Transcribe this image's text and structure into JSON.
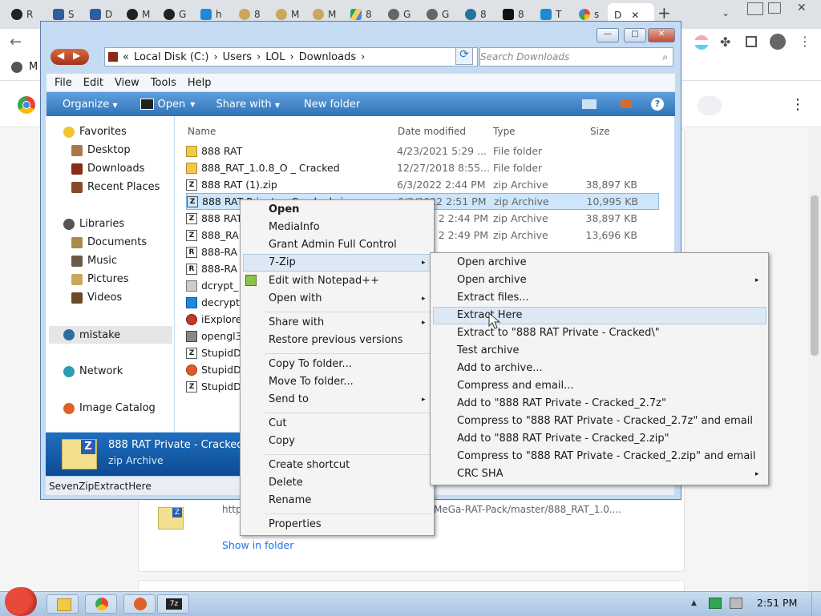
{
  "browser": {
    "tabs": [
      {
        "label": "R",
        "icon": "github-icon"
      },
      {
        "label": "S",
        "icon": "site-icon"
      },
      {
        "label": "D",
        "icon": "site-icon"
      },
      {
        "label": "M",
        "icon": "github-icon"
      },
      {
        "label": "G",
        "icon": "github-icon"
      },
      {
        "label": "h",
        "icon": "site-icon"
      },
      {
        "label": "8",
        "icon": "site-icon"
      },
      {
        "label": "M",
        "icon": "site-icon"
      },
      {
        "label": "M",
        "icon": "site-icon"
      },
      {
        "label": "8",
        "icon": "drive-icon"
      },
      {
        "label": "G",
        "icon": "globe-icon"
      },
      {
        "label": "G",
        "icon": "globe-icon"
      },
      {
        "label": "8",
        "icon": "wordpress-icon"
      },
      {
        "label": "8",
        "icon": "site-icon"
      },
      {
        "label": "T",
        "icon": "site-icon"
      },
      {
        "label": "s",
        "icon": "google-icon"
      },
      {
        "label": "D",
        "icon": "downloads-icon"
      }
    ],
    "new_tab": "+",
    "bookmark_m": "M",
    "download": {
      "url_left": "http",
      "url_right": "MeGa-RAT-Pack/master/888_RAT_1.0....",
      "show_in_folder": "Show in folder"
    }
  },
  "explorer": {
    "window_buttons": {
      "minimize": "—",
      "maximize": "□",
      "close": "✕"
    },
    "address": {
      "prefix": "«",
      "parts": [
        "Local Disk (C:)",
        "Users",
        "LOL",
        "Downloads"
      ],
      "sep": "›"
    },
    "search_placeholder": "Search Downloads",
    "menu": [
      "File",
      "Edit",
      "View",
      "Tools",
      "Help"
    ],
    "toolbar": {
      "organize": "Organize",
      "open": "Open",
      "share_with": "Share with",
      "new_folder": "New folder"
    },
    "nav": {
      "favorites": "Favorites",
      "desktop": "Desktop",
      "downloads": "Downloads",
      "recent": "Recent Places",
      "libraries": "Libraries",
      "documents": "Documents",
      "music": "Music",
      "pictures": "Pictures",
      "videos": "Videos",
      "mistake": "mistake",
      "network": "Network",
      "image_catalog": "Image Catalog"
    },
    "columns": {
      "name": "Name",
      "date": "Date modified",
      "type": "Type",
      "size": "Size"
    },
    "files": [
      {
        "name": "888 RAT",
        "date": "4/23/2021 5:29 ...",
        "type": "File folder",
        "size": ""
      },
      {
        "name": "888_RAT_1.0.8_O _ Cracked",
        "date": "12/27/2018 8:55...",
        "type": "File folder",
        "size": ""
      },
      {
        "name": "888 RAT (1).zip",
        "date": "6/3/2022 2:44 PM",
        "type": "zip Archive",
        "size": "38,897 KB"
      },
      {
        "name": "888 RAT Private - Cracked.zip",
        "date": "6/3/2022 2:51 PM",
        "type": "zip Archive",
        "size": "10,995 KB"
      },
      {
        "name": "888 RAT",
        "date": "2 2:44 PM",
        "type": "zip Archive",
        "size": "38,897 KB"
      },
      {
        "name": "888_RA",
        "date": "2 2:49 PM",
        "type": "zip Archive",
        "size": "13,696 KB"
      },
      {
        "name": "888-RA",
        "date": "",
        "type": "",
        "size": ""
      },
      {
        "name": "888-RA",
        "date": "",
        "type": "",
        "size": ""
      },
      {
        "name": "dcrypt_",
        "date": "",
        "type": "",
        "size": ""
      },
      {
        "name": "decrypt",
        "date": "",
        "type": "",
        "size": ""
      },
      {
        "name": "iExplore",
        "date": "",
        "type": "",
        "size": ""
      },
      {
        "name": "opengl3",
        "date": "",
        "type": "",
        "size": ""
      },
      {
        "name": "StupidD",
        "date": "",
        "type": "",
        "size": ""
      },
      {
        "name": "StupidD",
        "date": "",
        "type": "",
        "size": ""
      },
      {
        "name": "StupidD",
        "date": "",
        "type": "",
        "size": ""
      }
    ],
    "details": {
      "name": "888 RAT Private - Cracked.",
      "type": "zip Archive"
    },
    "status": "SevenZipExtractHere"
  },
  "context_menu": {
    "open": "Open",
    "mediainfo": "MediaInfo",
    "grant": "Grant Admin Full Control",
    "sevenzip": "7-Zip",
    "notepad": "Edit with Notepad++",
    "open_with": "Open with",
    "share_with": "Share with",
    "restore": "Restore previous versions",
    "copy_to": "Copy To folder...",
    "move_to": "Move To folder...",
    "send_to": "Send to",
    "cut": "Cut",
    "copy": "Copy",
    "create_shortcut": "Create shortcut",
    "delete": "Delete",
    "rename": "Rename",
    "properties": "Properties",
    "arrow": "▸"
  },
  "submenu": {
    "items": [
      "Open archive",
      "Open archive",
      "Extract files...",
      "Extract Here",
      "Extract to \"888 RAT Private - Cracked\\\"",
      "Test archive",
      "Add to archive...",
      "Compress and email...",
      "Add to \"888 RAT Private - Cracked_2.7z\"",
      "Compress to \"888 RAT Private - Cracked_2.7z\" and email",
      "Add to \"888 RAT Private - Cracked_2.zip\"",
      "Compress to \"888 RAT Private - Cracked_2.zip\" and email",
      "CRC SHA"
    ]
  },
  "taskbar": {
    "clock": "2:51 PM"
  }
}
